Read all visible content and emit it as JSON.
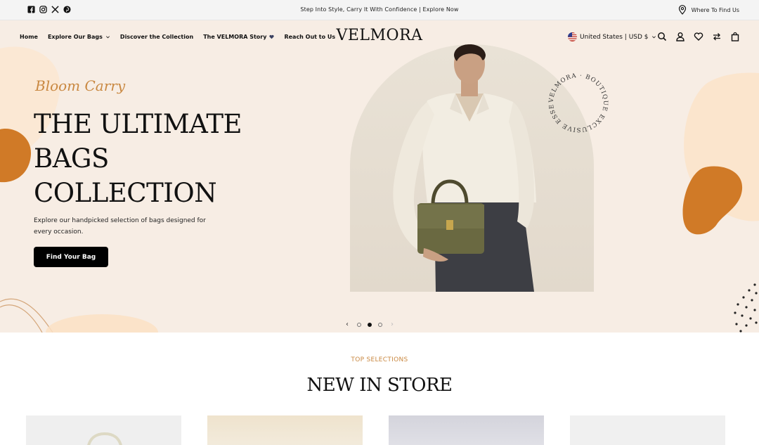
{
  "topbar": {
    "social": [
      "facebook-icon",
      "instagram-icon",
      "x-icon",
      "pinterest-icon"
    ],
    "announcement": "Step Into Style, Carry It With Confidence | Explore Now",
    "find_us": "Where To Find Us"
  },
  "nav": {
    "items": [
      {
        "label": "Home"
      },
      {
        "label": "Explore Our Bags"
      },
      {
        "label": "Discover the Collection"
      },
      {
        "label": "The VELMORA Story"
      },
      {
        "label": "Reach Out to Us"
      }
    ],
    "logo": "VELMORA",
    "region": "United States | USD $",
    "icons": [
      "search-icon",
      "account-icon",
      "wishlist-icon",
      "compare-icon",
      "cart-icon"
    ]
  },
  "hero": {
    "script_title": "Bloom Carry",
    "headline_lines": [
      "THE ULTIMATE",
      "BAGS",
      "COLLECTION"
    ],
    "description": "Explore our handpicked selection of bags designed for every occasion.",
    "cta": "Find Your Bag",
    "badge_text": "VELMORA · BOUTIQUE EXCLUSIVE ESSENTIALS ·",
    "slider": {
      "prev": "‹",
      "next": "›",
      "active_slide": 2,
      "total_slides": 3
    }
  },
  "section": {
    "eyebrow": "TOP SELECTIONS",
    "title": "NEW IN STORE"
  },
  "colors": {
    "accent": "#c98841",
    "blob": "#d07a27",
    "hero_bg": "#f7ede4",
    "button": "#000000"
  }
}
